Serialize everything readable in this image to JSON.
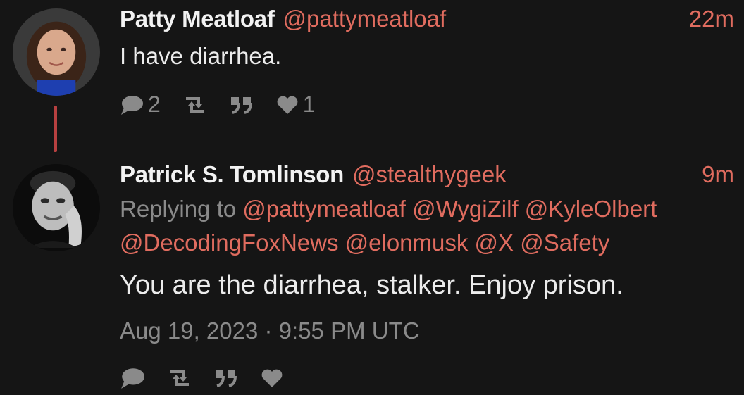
{
  "tweet1": {
    "author": "Patty Meatloaf",
    "handle": "@pattymeatloaf",
    "time": "22m",
    "text": "I have diarrhea.",
    "reply_count": "2",
    "like_count": "1"
  },
  "tweet2": {
    "author": "Patrick S. Tomlinson",
    "handle": "@stealthygeek",
    "time": "9m",
    "replying_prefix": "Replying to",
    "mentions_line1": [
      "@pattymeatloaf",
      "@WygiZilf",
      "@KyleOlbert"
    ],
    "mentions_line2": [
      "@DecodingFoxNews",
      "@elonmusk",
      "@X",
      "@Safety"
    ],
    "text": "You are the diarrhea, stalker. Enjoy prison.",
    "timestamp": "Aug 19, 2023 · 9:55 PM UTC"
  },
  "colors": {
    "background": "#151515",
    "accent": "#e06c5f",
    "thread_line": "#b74040",
    "muted": "#8a8a8a"
  },
  "icons": [
    "comment-icon",
    "retweet-icon",
    "quote-icon",
    "heart-icon"
  ]
}
